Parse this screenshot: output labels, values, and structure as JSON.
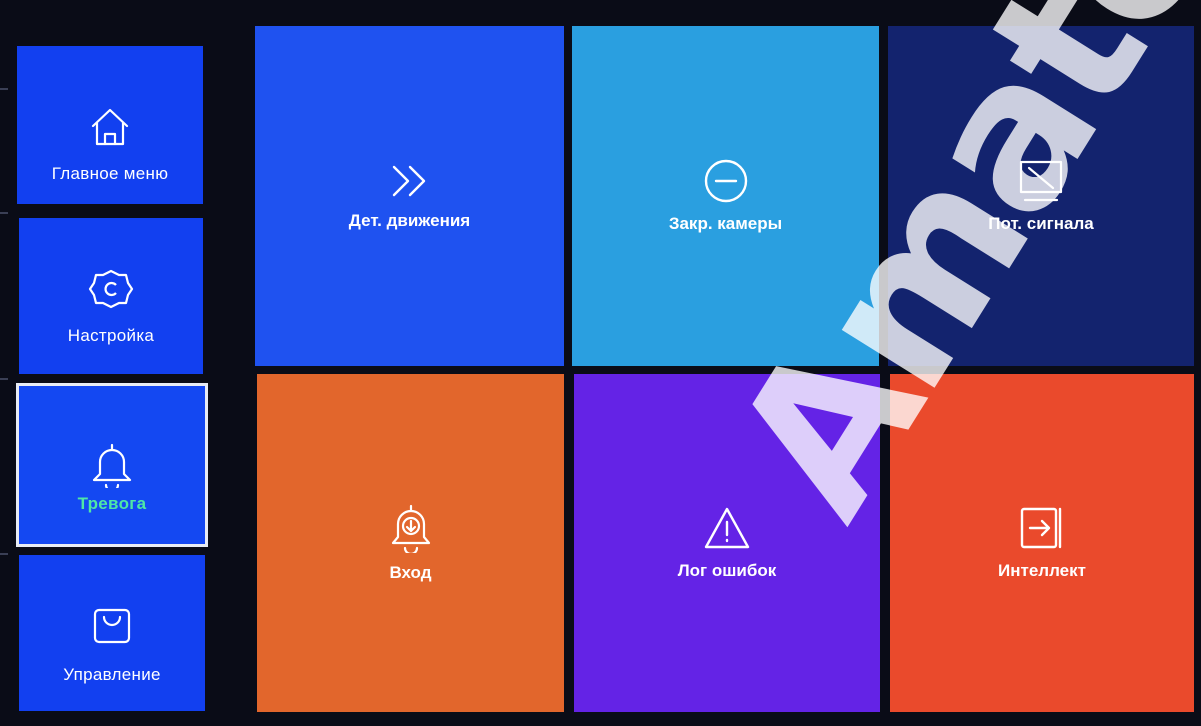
{
  "sidebar": {
    "items": [
      {
        "label": "Главное меню",
        "icon": "home-icon"
      },
      {
        "label": "Настройка",
        "icon": "gear-icon"
      },
      {
        "label": "Тревога",
        "icon": "bell-icon",
        "active": true
      },
      {
        "label": "Управление",
        "icon": "bag-icon"
      }
    ]
  },
  "tiles": [
    {
      "label": "Дет. движения",
      "icon": "double-chevron-right-icon",
      "color": "#1f52f0"
    },
    {
      "label": "Закр. камеры",
      "icon": "minus-circle-icon",
      "color": "#2a9fe0"
    },
    {
      "label": "Пот. сигнала",
      "icon": "signal-lost-monitor-icon",
      "color": "#13236e"
    },
    {
      "label": "Вход",
      "icon": "bell-download-icon",
      "color": "#e2662c"
    },
    {
      "label": "Лог ошибок",
      "icon": "warning-triangle-icon",
      "color": "#6423e6"
    },
    {
      "label": "Интеллект",
      "icon": "enter-icon",
      "color": "#ea4a2c"
    }
  ],
  "colors": {
    "sidebar_bg": "#1040f2",
    "active_label": "#4fe6a6"
  },
  "watermark": "Amatek"
}
